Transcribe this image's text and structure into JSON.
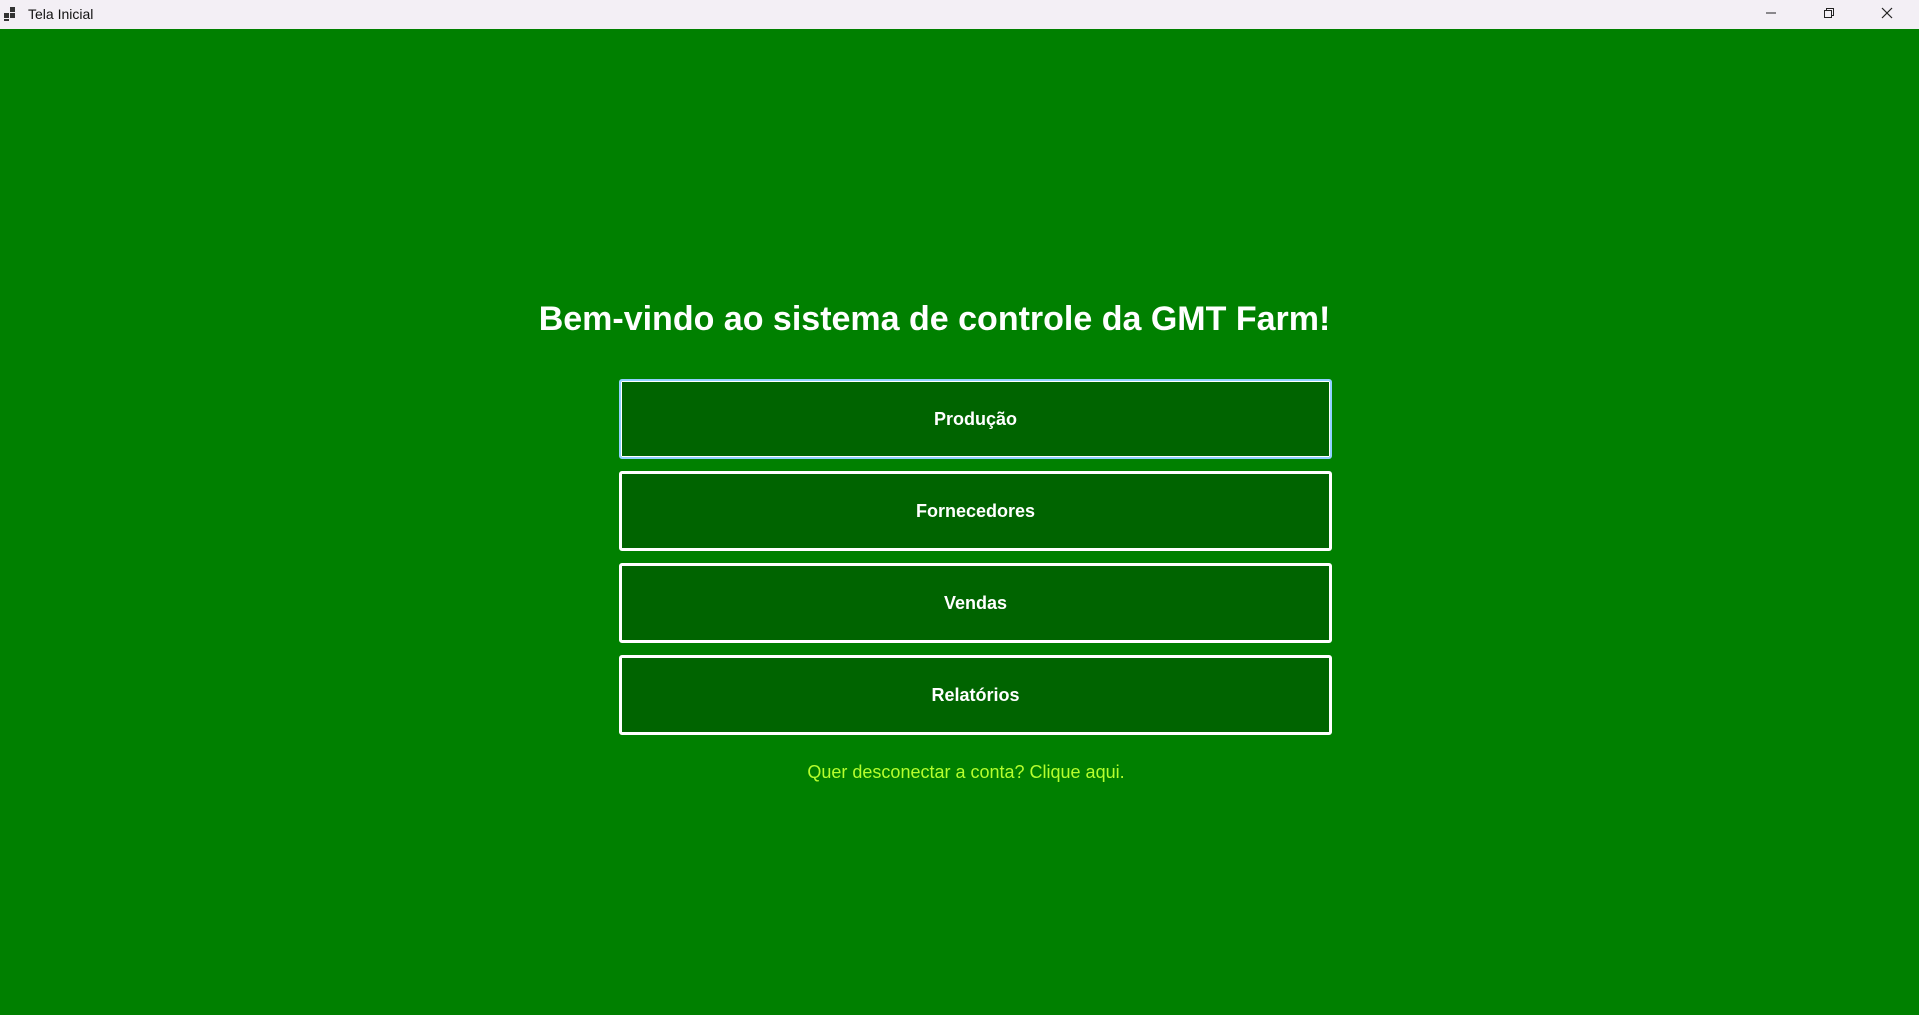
{
  "window": {
    "title": "Tela Inicial",
    "icon": "app-window-icon",
    "controls": [
      "minimize-icon",
      "restore-icon",
      "close-icon"
    ]
  },
  "main": {
    "heading": "Bem-vindo ao sistema de controle da GMT Farm!",
    "buttons": [
      {
        "label": "Produção"
      },
      {
        "label": "Fornecedores"
      },
      {
        "label": "Vendas"
      },
      {
        "label": "Relatórios"
      }
    ],
    "logout_link": "Quer desconectar a conta? Clique aqui."
  },
  "colors": {
    "background": "#008000",
    "button_background": "#006400",
    "button_border": "#ffffff",
    "link": "#b5ff2e",
    "focus_border": "#8fd0ff"
  }
}
